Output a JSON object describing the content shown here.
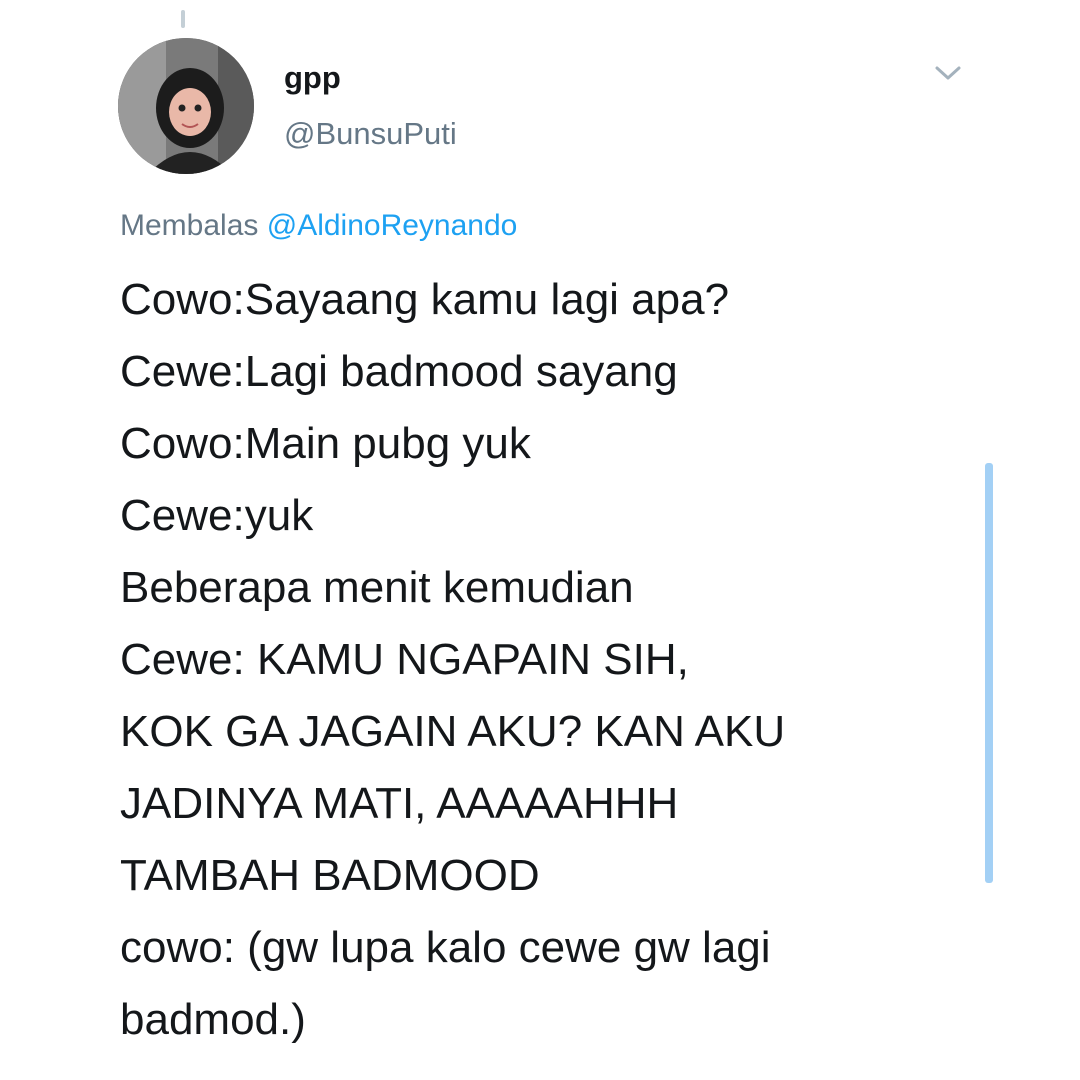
{
  "tweet": {
    "display_name": "gpp",
    "handle": "@BunsuPuti",
    "reply_prefix": "Membalas",
    "reply_to": "@AldinoReynando",
    "lines": [
      "Cowo:Sayaang kamu lagi apa?",
      "Cewe:Lagi badmood sayang",
      "Cowo:Main pubg yuk",
      "Cewe:yuk",
      "Beberapa menit kemudian",
      "Cewe: KAMU NGAPAIN SIH,",
      "KOK GA JAGAIN AKU? KAN AKU",
      "JADINYA MATI, AAAAAHHH",
      "TAMBAH BADMOOD",
      "cowo: (gw lupa kalo cewe gw lagi",
      "badmod.)"
    ]
  },
  "icons": {
    "menu": "chevron-down-icon",
    "avatar": "user-avatar-photo"
  },
  "colors": {
    "text_primary": "#14171a",
    "text_secondary": "#657786",
    "link": "#1da1f2",
    "scrollbar": "#a3d0f5"
  }
}
